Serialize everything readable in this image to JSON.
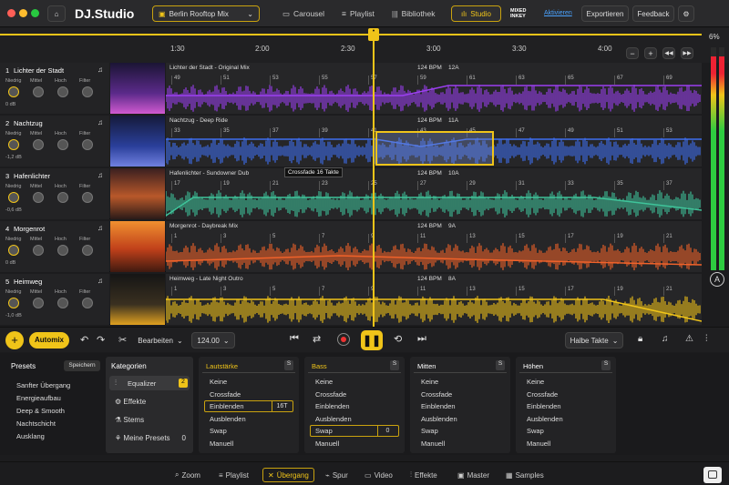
{
  "app": {
    "logo": "DJ.Studio",
    "mix_name": "Berlin Rooftop Mix",
    "nav": [
      "Carousel",
      "Playlist",
      "Bibliothek",
      "Studio"
    ],
    "mixedinkey": "MIXED INKEY",
    "activate": "Aktivieren",
    "export": "Exportieren",
    "feedback": "Feedback"
  },
  "ruler": {
    "ticks": [
      "1:30",
      "2:00",
      "2:30",
      "3:00",
      "3:30",
      "4:00"
    ],
    "zoom": "6%"
  },
  "tracks": [
    {
      "num": "1",
      "name": "Lichter der Stadt",
      "title": "Lichter der Stadt - Original Mix",
      "bpm": "124 BPM",
      "key": "12A",
      "gain": "0 dB",
      "beats": [
        "49",
        "51",
        "53",
        "55",
        "57",
        "59",
        "61",
        "63",
        "65",
        "67",
        "69"
      ],
      "color": "#9b3ff0"
    },
    {
      "num": "2",
      "name": "Nachtzug",
      "title": "Nachtzug - Deep Ride",
      "bpm": "124 BPM",
      "key": "11A",
      "gain": "-1,2 dB",
      "beats": [
        "33",
        "35",
        "37",
        "39",
        "41",
        "43",
        "45",
        "47",
        "49",
        "51",
        "53"
      ],
      "color": "#3f6ef0"
    },
    {
      "num": "3",
      "name": "Hafenlichter",
      "title": "Hafenlichter - Sundowner Dub",
      "bpm": "124 BPM",
      "key": "10A",
      "gain": "-0,6 dB",
      "beats": [
        "17",
        "19",
        "21",
        "23",
        "25",
        "27",
        "29",
        "31",
        "33",
        "35",
        "37"
      ],
      "color": "#3fc49a"
    },
    {
      "num": "4",
      "name": "Morgenrot",
      "title": "Morgenrot - Daybreak Mix",
      "bpm": "124 BPM",
      "key": "9A",
      "gain": "0 dB",
      "beats": [
        "1",
        "3",
        "5",
        "7",
        "9",
        "11",
        "13",
        "15",
        "17",
        "19",
        "21"
      ],
      "color": "#f0622a"
    },
    {
      "num": "5",
      "name": "Heimweg",
      "title": "Heimweg - Late Night Outro",
      "bpm": "124 BPM",
      "key": "8A",
      "gain": "-1,0 dB",
      "beats": [
        "1",
        "3",
        "5",
        "7",
        "9",
        "11",
        "13",
        "15",
        "17",
        "19",
        "21"
      ],
      "color": "#f0c419"
    }
  ],
  "knobs": [
    "Niedrig",
    "Mittel",
    "Hoch",
    "Filter"
  ],
  "crossfade_label": "Crossfade 16 Takte",
  "transport": {
    "automix": "Automix",
    "edit": "Bearbeiten",
    "bpm": "124.00",
    "bars": "Halbe Takte"
  },
  "presets": {
    "title": "Presets",
    "save": "Speichern",
    "items": [
      "Sanfter Übergang",
      "Energieaufbau",
      "Deep & Smooth",
      "Nachtschicht",
      "Ausklang"
    ]
  },
  "categories": {
    "title": "Kategorien",
    "items": [
      "Equalizer",
      "Effekte",
      "Stems",
      "Meine Presets"
    ],
    "eq_count": "2",
    "mine_count": "0"
  },
  "columns": [
    {
      "title": "Lautstärke",
      "opts": [
        "Keine",
        "Crossfade",
        "Einblenden",
        "Ausblenden",
        "Swap",
        "Manuell"
      ],
      "sel": 2,
      "val": "16T"
    },
    {
      "title": "Bass",
      "opts": [
        "Keine",
        "Crossfade",
        "Einblenden",
        "Ausblenden",
        "Swap",
        "Manuell"
      ],
      "sel": 4,
      "val": "0"
    },
    {
      "title": "Mitten",
      "opts": [
        "Keine",
        "Crossfade",
        "Einblenden",
        "Ausblenden",
        "Swap",
        "Manuell"
      ],
      "sel": -1,
      "val": ""
    },
    {
      "title": "Höhen",
      "opts": [
        "Keine",
        "Crossfade",
        "Einblenden",
        "Ausblenden",
        "Swap",
        "Manuell"
      ],
      "sel": -1,
      "val": ""
    }
  ],
  "footer": [
    "Zoom",
    "Playlist",
    "Übergang",
    "Spur",
    "Video",
    "Effekte",
    "Master",
    "Samples"
  ],
  "s_label": "S"
}
